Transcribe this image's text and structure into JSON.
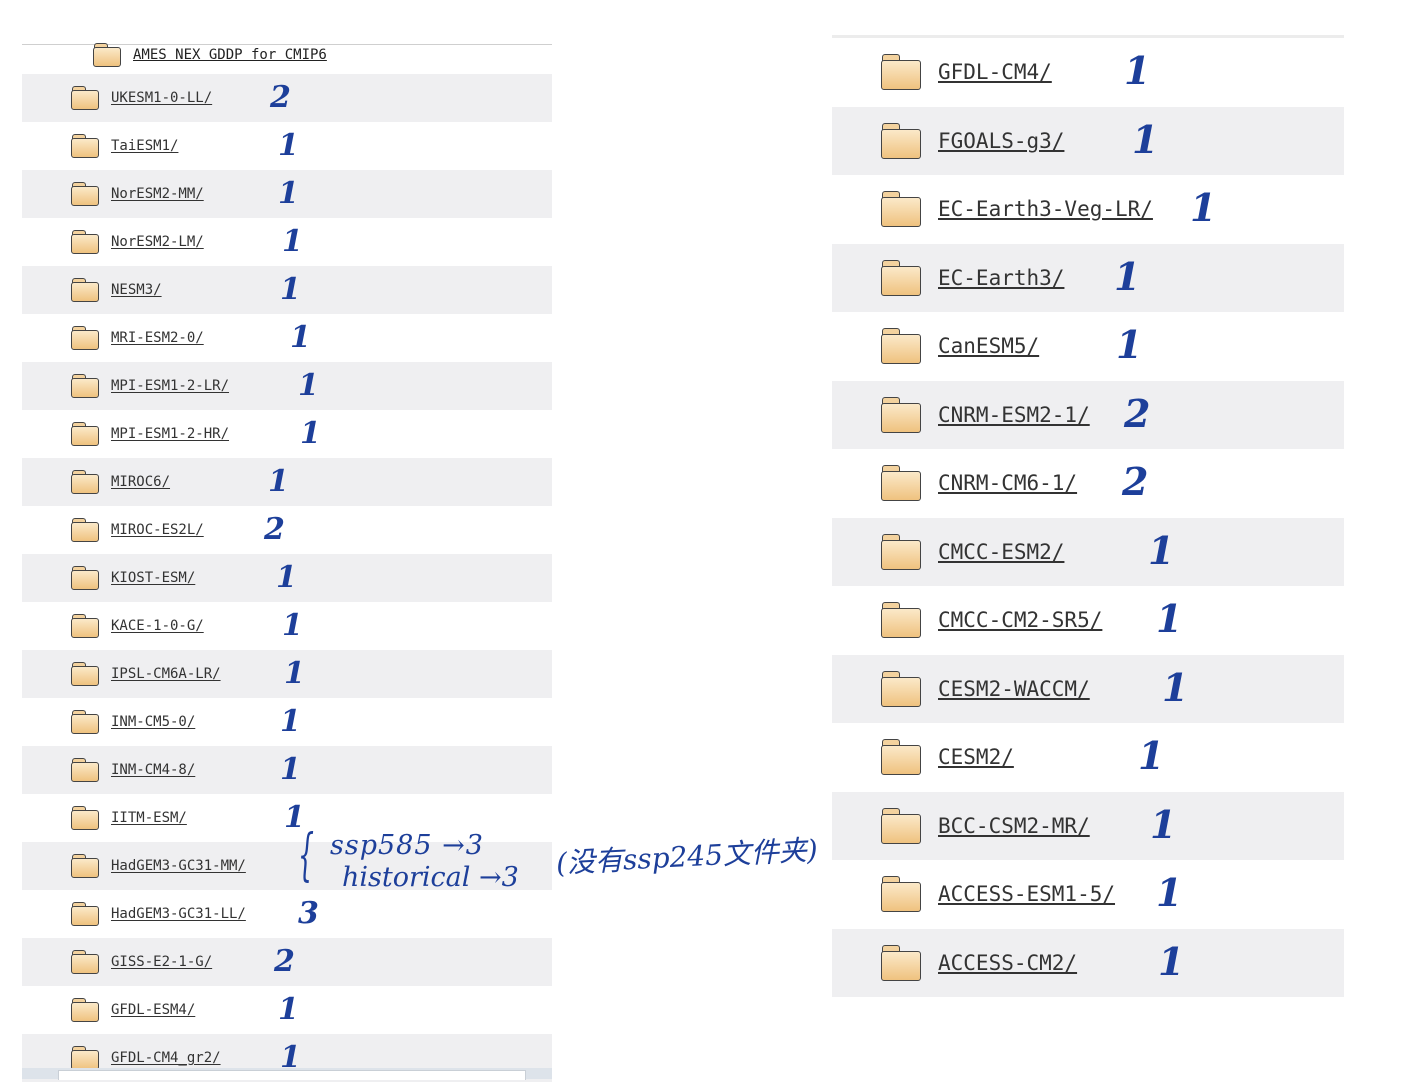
{
  "left_panel": {
    "header": "AMES NEX GDDP for CMIP6",
    "items": [
      {
        "name": "UKESM1-0-LL/",
        "count": "2"
      },
      {
        "name": "TaiESM1/",
        "count": "1"
      },
      {
        "name": "NorESM2-MM/",
        "count": "1"
      },
      {
        "name": "NorESM2-LM/",
        "count": "1"
      },
      {
        "name": "NESM3/",
        "count": "1"
      },
      {
        "name": "MRI-ESM2-0/",
        "count": "1"
      },
      {
        "name": "MPI-ESM1-2-LR/",
        "count": "1"
      },
      {
        "name": "MPI-ESM1-2-HR/",
        "count": "1"
      },
      {
        "name": "MIROC6/",
        "count": "1"
      },
      {
        "name": "MIROC-ES2L/",
        "count": "2"
      },
      {
        "name": "KIOST-ESM/",
        "count": "1"
      },
      {
        "name": "KACE-1-0-G/",
        "count": "1"
      },
      {
        "name": "IPSL-CM6A-LR/",
        "count": "1"
      },
      {
        "name": "INM-CM5-0/",
        "count": "1"
      },
      {
        "name": "INM-CM4-8/",
        "count": "1"
      },
      {
        "name": "IITM-ESM/",
        "count": "1"
      },
      {
        "name": "HadGEM3-GC31-MM/",
        "count": ""
      },
      {
        "name": "HadGEM3-GC31-LL/",
        "count": "3"
      },
      {
        "name": "GISS-E2-1-G/",
        "count": "2"
      },
      {
        "name": "GFDL-ESM4/",
        "count": "1"
      },
      {
        "name": "GFDL-CM4_gr2/",
        "count": "1"
      }
    ]
  },
  "right_panel": {
    "items": [
      {
        "name": "GFDL-CM4/",
        "count": "1"
      },
      {
        "name": "FGOALS-g3/",
        "count": "1"
      },
      {
        "name": "EC-Earth3-Veg-LR/",
        "count": "1"
      },
      {
        "name": "EC-Earth3/",
        "count": "1"
      },
      {
        "name": "CanESM5/",
        "count": "1"
      },
      {
        "name": "CNRM-ESM2-1/",
        "count": "2"
      },
      {
        "name": "CNRM-CM6-1/",
        "count": "2"
      },
      {
        "name": "CMCC-ESM2/",
        "count": "1"
      },
      {
        "name": "CMCC-CM2-SR5/",
        "count": "1"
      },
      {
        "name": "CESM2-WACCM/",
        "count": "1"
      },
      {
        "name": "CESM2/",
        "count": "1"
      },
      {
        "name": "BCC-CSM2-MR/",
        "count": "1"
      },
      {
        "name": "ACCESS-ESM1-5/",
        "count": "1"
      },
      {
        "name": "ACCESS-CM2/",
        "count": "1"
      }
    ]
  },
  "annotation": {
    "brace": "{",
    "line1": "ssp585 →3",
    "line2": "historical →3",
    "note": "(没有ssp245文件夹)"
  },
  "colors": {
    "ink": "#1d3f9a",
    "row_shade": "#efeff1",
    "folder_fill": "#efc27f"
  },
  "icons": {
    "folder": "folder-icon"
  }
}
